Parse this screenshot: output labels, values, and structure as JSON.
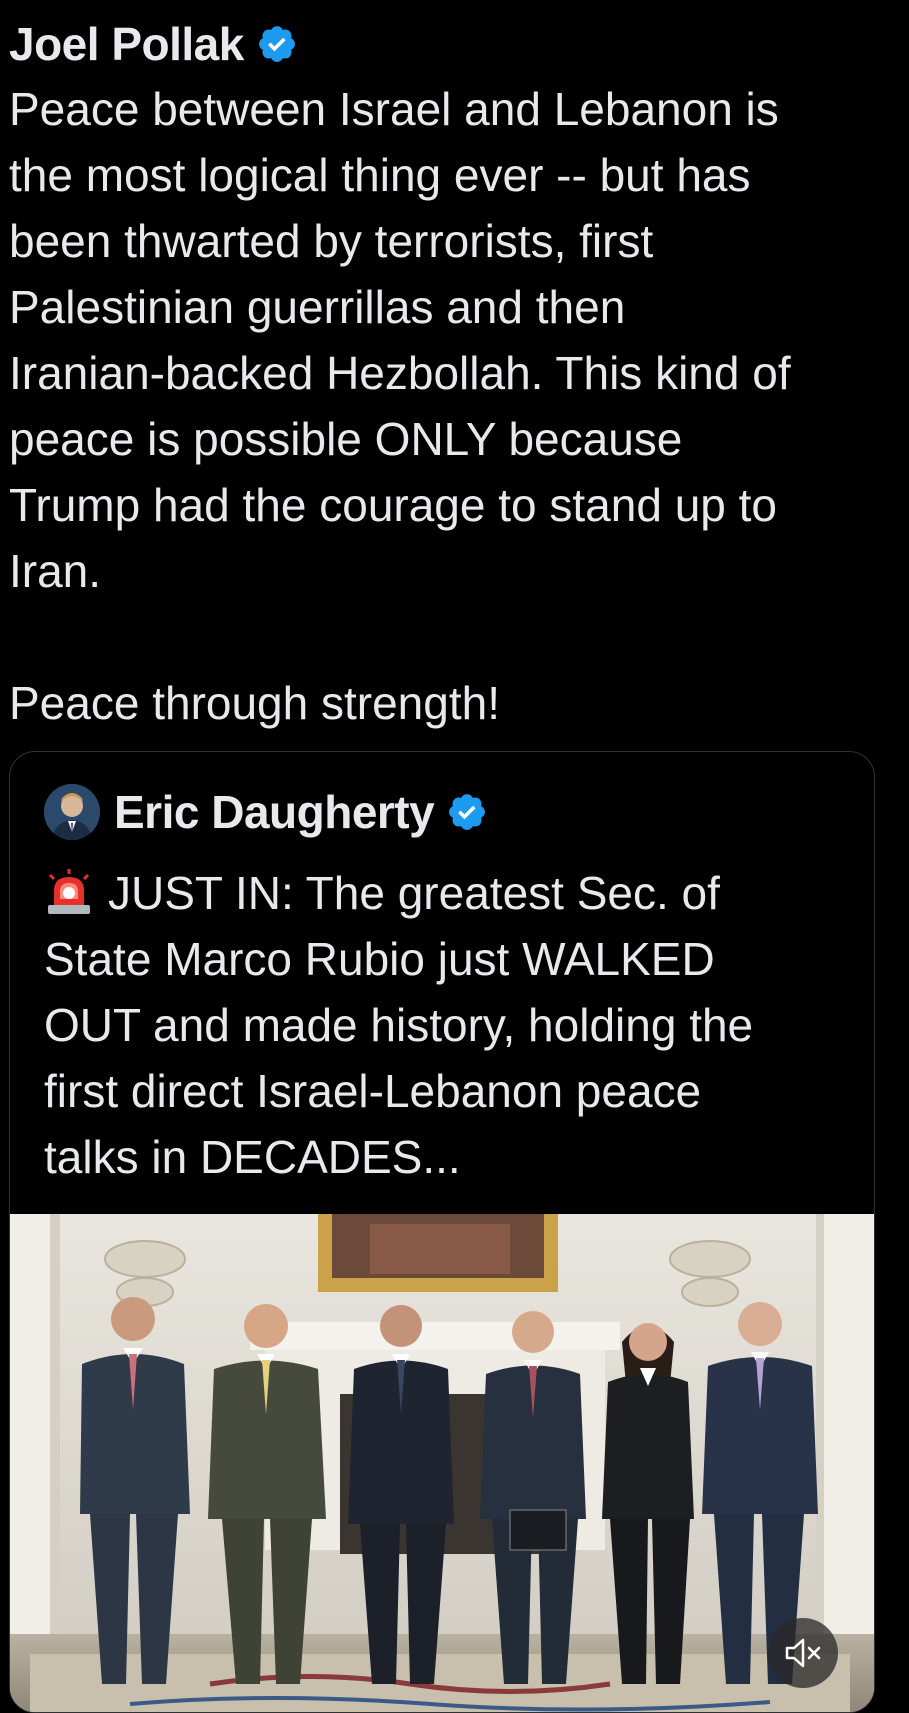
{
  "post": {
    "author_name": "Joel Pollak",
    "verified_icon": "verified-badge-icon",
    "text": "Peace between Israel and Lebanon is\nthe most logical thing ever -- but has\nbeen thwarted by terrorists, first\nPalestinian guerrillas and then\nIranian-backed Hezbollah. This kind of\npeace is possible ONLY because\nTrump had the courage to stand up to\nIran.\n\nPeace through strength!"
  },
  "quoted_post": {
    "author_name": "Eric Daugherty",
    "verified_icon": "verified-badge-icon",
    "emoji": "siren-emoji-icon",
    "text": "JUST IN: The greatest Sec. of\nState Marco Rubio just WALKED\nOUT and made history, holding the\nfirst direct Israel-Lebanon peace\ntalks in DECADES..."
  },
  "media": {
    "type": "video",
    "mute_icon": "speaker-muted-icon"
  },
  "colors": {
    "background": "#000000",
    "text": "#e7e9ea",
    "verified": "#1d9bf0",
    "border": "#2f3336"
  }
}
